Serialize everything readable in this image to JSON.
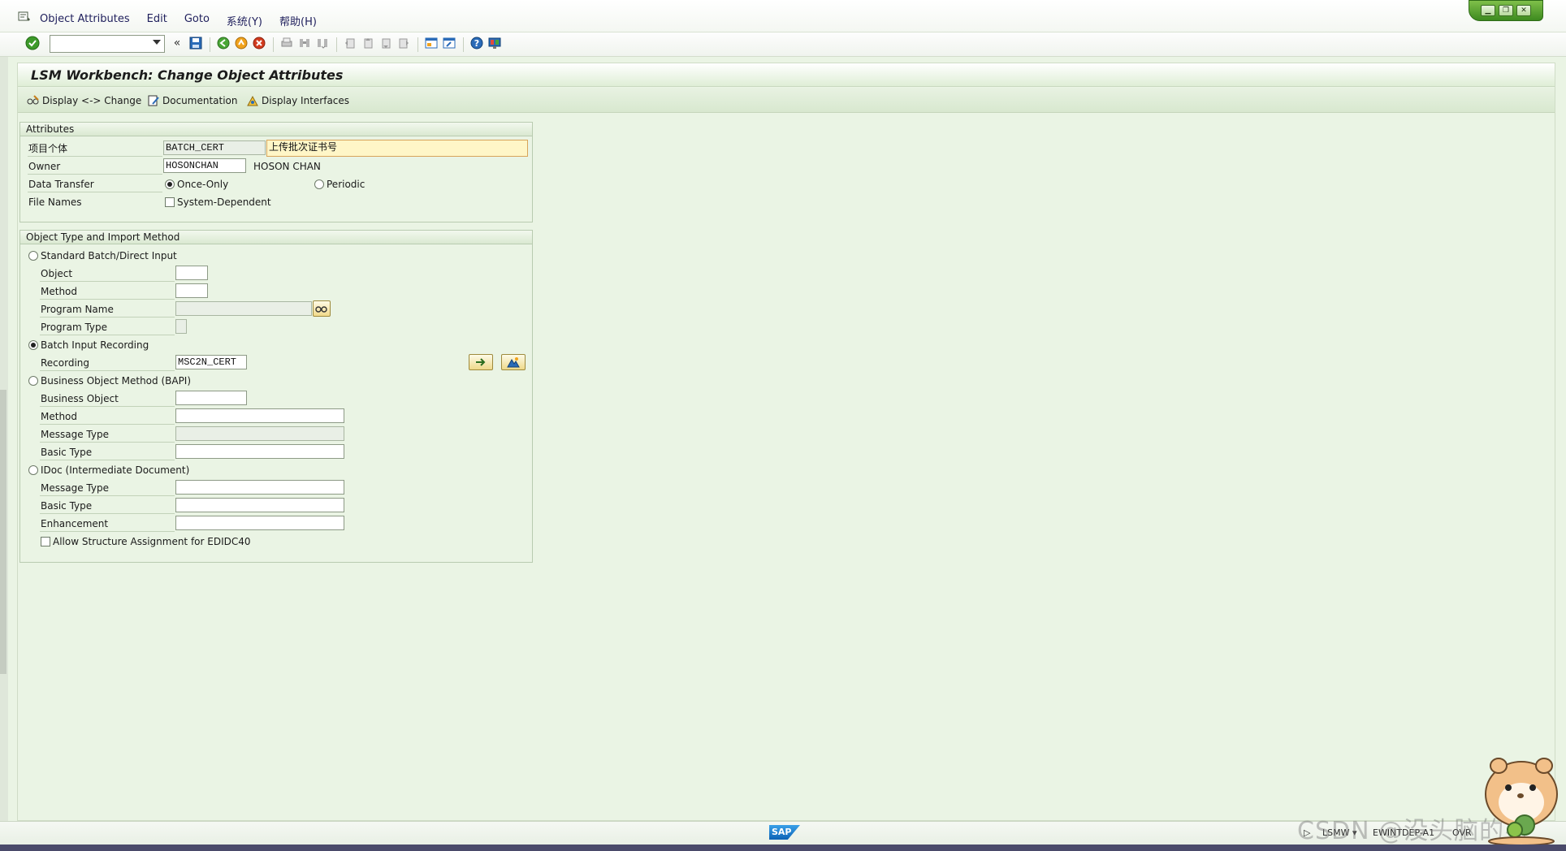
{
  "menu": {
    "items": [
      {
        "label": "Object Attributes"
      },
      {
        "label": "Edit"
      },
      {
        "label": "Goto"
      },
      {
        "label": "系统(Y)"
      },
      {
        "label": "帮助(H)"
      }
    ]
  },
  "toolbar": {
    "command_field_value": ""
  },
  "page": {
    "title": "LSM Workbench: Change Object Attributes"
  },
  "app_toolbar": {
    "display_change": "Display <-> Change",
    "documentation": "Documentation",
    "display_interfaces": "Display Interfaces"
  },
  "attributes": {
    "title": "Attributes",
    "item_label": "项目个体",
    "item_value": "BATCH_CERT",
    "item_description": "上传批次证书号",
    "owner_label": "Owner",
    "owner_value": "HOSONCHAN",
    "owner_name": "HOSON CHAN",
    "data_transfer_label": "Data Transfer",
    "once_only": "Once-Only",
    "periodic": "Periodic",
    "file_names_label": "File Names",
    "system_dependent": "System-Dependent"
  },
  "import_method": {
    "title": "Object Type and Import Method",
    "standard_batch": "Standard Batch/Direct Input",
    "object_label": "Object",
    "method_label": "Method",
    "program_name_label": "Program Name",
    "program_type_label": "Program Type",
    "batch_input_recording": "Batch Input Recording",
    "recording_label": "Recording",
    "recording_value": "MSC2N_CERT",
    "bapi": "Business Object Method  (BAPI)",
    "business_object_label": "Business Object",
    "bapi_method_label": "Method",
    "bapi_message_type_label": "Message Type",
    "bapi_basic_type_label": "Basic Type",
    "idoc": "IDoc (Intermediate Document)",
    "idoc_message_type_label": "Message Type",
    "idoc_basic_type_label": "Basic Type",
    "enhancement_label": "Enhancement",
    "allow_structure": "Allow Structure Assignment for EDIDC40"
  },
  "status": {
    "transaction": "LSMW",
    "server": "EWINTDEP-A1",
    "mode": "OVR",
    "watermark": "CSDN @没头脑的男"
  },
  "colors": {
    "background": "#eaf4e4",
    "window_controls": "#3d8a1f",
    "highlight_field": "#fff6c7"
  }
}
